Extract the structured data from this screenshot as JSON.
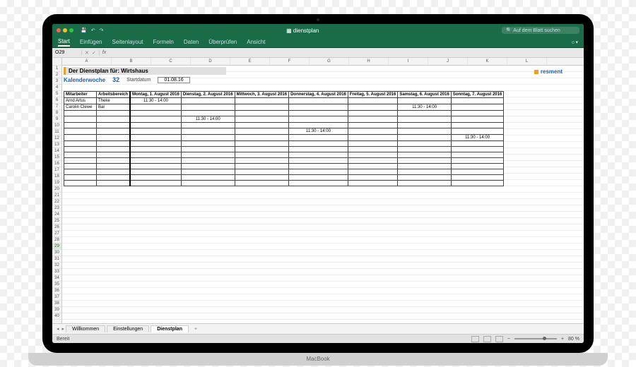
{
  "titlebar": {
    "doc_title": "dienstplan",
    "search_placeholder": "Auf dem Blatt suchen"
  },
  "ribbon": {
    "tabs": [
      "Start",
      "Einfügen",
      "Seitenlayout",
      "Formeln",
      "Daten",
      "Überprüfen",
      "Ansicht"
    ]
  },
  "formula_bar": {
    "name_box": "O29",
    "fx": "fx"
  },
  "columns": [
    "A",
    "B",
    "C",
    "D",
    "E",
    "F",
    "G",
    "H",
    "I",
    "J",
    "K",
    "L"
  ],
  "rows": 40,
  "plan": {
    "title": "Der Dienstplan für: Wirtshaus",
    "kw_label": "Kalenderwoche",
    "kw_value": "32",
    "start_label": "Startdatum",
    "start_value": "01.08.16",
    "brand": "resment"
  },
  "schedule": {
    "headers": [
      "Mitarbeiter",
      "Arbeitsbereich",
      "Montag, 1. August 2016",
      "Dienstag, 2. August 2016",
      "Mittwoch, 3. August 2016",
      "Donnerstag, 4. August 2016",
      "Freitag, 5. August 2016",
      "Samstag, 6. August 2016",
      "Sonntag, 7. August 2016"
    ],
    "rows": [
      {
        "employee": "Arnd Artus",
        "area": "Theke",
        "cells": [
          "11:30 - 14:00",
          "",
          "",
          "",
          "",
          "",
          ""
        ]
      },
      {
        "employee": "Carolin Clewe",
        "area": "Bar",
        "cells": [
          "",
          "",
          "",
          "",
          "",
          "11:30 - 14:00",
          ""
        ]
      },
      {
        "employee": "",
        "area": "",
        "cells": [
          "",
          "",
          "",
          "",
          "",
          "",
          ""
        ]
      },
      {
        "employee": "",
        "area": "",
        "cells": [
          "",
          "11:30 - 14:00",
          "",
          "",
          "",
          "",
          ""
        ]
      },
      {
        "employee": "",
        "area": "",
        "cells": [
          "",
          "",
          "",
          "",
          "",
          "",
          ""
        ]
      },
      {
        "employee": "",
        "area": "",
        "cells": [
          "",
          "",
          "",
          "11:30 - 14:00",
          "",
          "",
          ""
        ]
      },
      {
        "employee": "",
        "area": "",
        "cells": [
          "",
          "",
          "",
          "",
          "",
          "",
          "11:30 - 14:00"
        ]
      },
      {
        "employee": "",
        "area": "",
        "cells": [
          "",
          "",
          "",
          "",
          "",
          "",
          ""
        ]
      },
      {
        "employee": "",
        "area": "",
        "cells": [
          "",
          "",
          "",
          "",
          "",
          "",
          ""
        ]
      },
      {
        "employee": "",
        "area": "",
        "cells": [
          "",
          "",
          "",
          "",
          "",
          "",
          ""
        ]
      },
      {
        "employee": "",
        "area": "",
        "cells": [
          "",
          "",
          "",
          "",
          "",
          "",
          ""
        ]
      },
      {
        "employee": "",
        "area": "",
        "cells": [
          "",
          "",
          "",
          "",
          "",
          "",
          ""
        ]
      },
      {
        "employee": "",
        "area": "",
        "cells": [
          "",
          "",
          "",
          "",
          "",
          "",
          ""
        ]
      },
      {
        "employee": "",
        "area": "",
        "cells": [
          "",
          "",
          "",
          "",
          "",
          "",
          ""
        ]
      },
      {
        "employee": "",
        "area": "",
        "cells": [
          "",
          "",
          "",
          "",
          "",
          "",
          ""
        ]
      }
    ]
  },
  "sheet_tabs": [
    "Willkommen",
    "Einstellungen",
    "Dienstplan"
  ],
  "status": {
    "ready": "Bereit",
    "zoom": "80 %"
  }
}
